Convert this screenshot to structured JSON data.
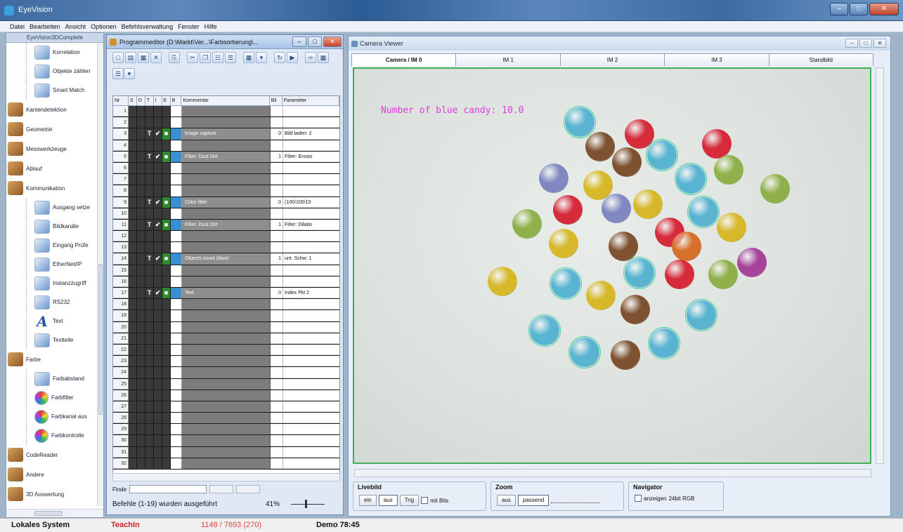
{
  "window": {
    "title": "EyeVision"
  },
  "menu": [
    "Datei",
    "Bearbeiten",
    "Ansicht",
    "Optionen",
    "Befehlsverwaltung",
    "Fenster",
    "Hilfe"
  ],
  "toolbox": {
    "header": "EyeVision3DComplete",
    "items": [
      {
        "type": "sub",
        "label": "Korrelation",
        "icon": "correlation-icon"
      },
      {
        "type": "sub",
        "label": "Objekte zählen",
        "icon": "count-objects-icon"
      },
      {
        "type": "sub",
        "label": "Smart Match",
        "icon": "smart-match-icon"
      },
      {
        "type": "cat",
        "label": "Kantendetektion",
        "icon": "edge-detection-icon"
      },
      {
        "type": "cat",
        "label": "Geometrie",
        "icon": "geometry-icon"
      },
      {
        "type": "cat",
        "label": "Messwerkzeuge",
        "icon": "measuring-tools-icon"
      },
      {
        "type": "cat",
        "label": "Ablauf",
        "icon": "workflow-icon"
      },
      {
        "type": "cat",
        "label": "Kommunikation",
        "icon": "communication-icon"
      },
      {
        "type": "sub",
        "label": "Ausgang setze",
        "icon": "set-output-icon"
      },
      {
        "type": "sub",
        "label": "Bildkanäle",
        "icon": "image-channels-icon"
      },
      {
        "type": "sub",
        "label": "Eingang Prüfe",
        "icon": "check-input-icon"
      },
      {
        "type": "sub",
        "label": "EtherNet/IP",
        "icon": "ethernet-icon"
      },
      {
        "type": "sub",
        "label": "Instanzzugriff",
        "icon": "instance-access-icon"
      },
      {
        "type": "sub",
        "label": "RS232",
        "icon": "rs232-icon"
      },
      {
        "type": "sub",
        "label": "Text",
        "icon": "text-icon"
      },
      {
        "type": "sub",
        "label": "Textteile",
        "icon": "text-parts-icon"
      },
      {
        "type": "cat",
        "label": "Farbe",
        "icon": "color-icon"
      },
      {
        "type": "sub",
        "label": "Farbabstand",
        "icon": "color-distance-icon"
      },
      {
        "type": "sub",
        "label": "Farbfilter",
        "icon": "color-filter-icon"
      },
      {
        "type": "sub",
        "label": "Farbkanal aus",
        "icon": "color-channel-icon"
      },
      {
        "type": "sub",
        "label": "Farbkontrolle",
        "icon": "color-control-icon"
      },
      {
        "type": "cat",
        "label": "CodeReader",
        "icon": "code-reader-icon"
      },
      {
        "type": "cat",
        "label": "Andere",
        "icon": "other-icon"
      },
      {
        "type": "cat",
        "label": "3D Auswertung",
        "icon": "3d-evaluation-icon"
      }
    ]
  },
  "program_editor": {
    "title": "Programmeditor (D:\\Markt\\Ver...\\Farbsortierung\\...",
    "columns": [
      "Nr",
      "S",
      "D",
      "T",
      "I",
      "E",
      "B",
      "Kommentar",
      "Bil",
      "Parameter"
    ],
    "rows": [
      {
        "nr": "1",
        "comment": "",
        "bil": "",
        "param": ""
      },
      {
        "nr": "2",
        "comment": "",
        "bil": "",
        "param": ""
      },
      {
        "nr": "3",
        "comment": "Image capture",
        "bil": "0",
        "param": "Bild laden: 2",
        "flags": true
      },
      {
        "nr": "4",
        "comment": "",
        "bil": "",
        "param": ""
      },
      {
        "nr": "5",
        "comment": "Filter: Dust Dirt",
        "bil": "1",
        "param": "Filter: Erosio",
        "flags": true
      },
      {
        "nr": "6",
        "comment": "",
        "bil": "",
        "param": ""
      },
      {
        "nr": "7",
        "comment": "",
        "bil": "",
        "param": ""
      },
      {
        "nr": "8",
        "comment": "",
        "bil": "",
        "param": ""
      },
      {
        "nr": "9",
        "comment": "Color filter",
        "bil": "0",
        "param": "(100/100/10",
        "flags": true
      },
      {
        "nr": "10",
        "comment": "",
        "bil": "",
        "param": ""
      },
      {
        "nr": "11",
        "comment": "Filter: Dust Dirt",
        "bil": "1",
        "param": "Filter: Dilatio",
        "flags": true
      },
      {
        "nr": "12",
        "comment": "",
        "bil": "",
        "param": ""
      },
      {
        "nr": "13",
        "comment": "",
        "bil": "",
        "param": ""
      },
      {
        "nr": "14",
        "comment": "Objects count (blue)",
        "bil": "1",
        "param": "unt. Schw: 1",
        "flags": true
      },
      {
        "nr": "15",
        "comment": "",
        "bil": "",
        "param": ""
      },
      {
        "nr": "16",
        "comment": "",
        "bil": "",
        "param": ""
      },
      {
        "nr": "17",
        "comment": "Text",
        "bil": "0",
        "param": "Index Pkt 2",
        "flags": true
      },
      {
        "nr": "18",
        "comment": "",
        "bil": "",
        "param": ""
      },
      {
        "nr": "19",
        "comment": "",
        "bil": "",
        "param": ""
      },
      {
        "nr": "20",
        "comment": "",
        "bil": "",
        "param": ""
      },
      {
        "nr": "21",
        "comment": "",
        "bil": "",
        "param": ""
      },
      {
        "nr": "22",
        "comment": "",
        "bil": "",
        "param": ""
      },
      {
        "nr": "23",
        "comment": "",
        "bil": "",
        "param": ""
      },
      {
        "nr": "24",
        "comment": "",
        "bil": "",
        "param": ""
      },
      {
        "nr": "25",
        "comment": "",
        "bil": "",
        "param": ""
      },
      {
        "nr": "26",
        "comment": "",
        "bil": "",
        "param": ""
      },
      {
        "nr": "27",
        "comment": "",
        "bil": "",
        "param": ""
      },
      {
        "nr": "28",
        "comment": "",
        "bil": "",
        "param": ""
      },
      {
        "nr": "29",
        "comment": "",
        "bil": "",
        "param": ""
      },
      {
        "nr": "30",
        "comment": "",
        "bil": "",
        "param": ""
      },
      {
        "nr": "31",
        "comment": "",
        "bil": "",
        "param": ""
      },
      {
        "nr": "32",
        "comment": "",
        "bil": "",
        "param": ""
      }
    ],
    "find_label": "Finde",
    "status": "Befehle (1-19) wurden ausgeführt",
    "zoom_percent": "41%"
  },
  "camera_viewer": {
    "title": "Camera Viewer",
    "tabs": [
      {
        "label": "Camera / IM 0",
        "active": true
      },
      {
        "label": "IM 1",
        "active": false
      },
      {
        "label": "IM 2",
        "active": false
      },
      {
        "label": "IM 3",
        "active": false
      },
      {
        "label": "Standbild",
        "active": false
      }
    ],
    "overlay_text": "Number of blue candy: 10.0",
    "live": {
      "label": "Livebild",
      "on": "ein",
      "off": "aus",
      "trig": "Trig",
      "with_image": "mit Bits"
    },
    "zoom": {
      "label": "Zoom",
      "off": "aus",
      "fit": "passend"
    },
    "navigator": {
      "label": "Navigator",
      "show": "anzeigen",
      "mode": "24bit RGB"
    }
  },
  "statusbar": {
    "system": "Lokales System",
    "mode": "TeachIn",
    "counter": "1148 / 7693 (270)",
    "demo": "Demo 78:45"
  },
  "colors": {
    "red": "#d52b3b",
    "yellow": "#d6b82a",
    "green": "#8fb04a",
    "blue": "#59b4d2",
    "purple": "#8088c2",
    "brown": "#7e5230",
    "orange": "#d6702c",
    "magenta": "#a7439b",
    "overlay": "#e03ae0",
    "frame": "#43b050"
  }
}
